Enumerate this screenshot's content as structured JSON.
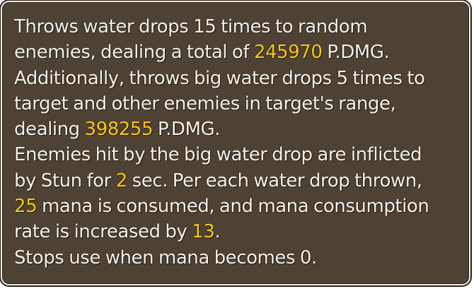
{
  "tooltip": {
    "lines": [
      {
        "a": "Throws water drops 15 times to random"
      },
      {
        "a": "enemies, dealing a total of ",
        "v": "245970",
        "b": " P.DMG."
      },
      {
        "a": "Additionally, throws big water drops 5 times to"
      },
      {
        "a": "target and other enemies in target's range,"
      },
      {
        "a": "dealing ",
        "v": "398255",
        "b": " P.DMG."
      },
      {
        "a": "Enemies hit by the big water drop are inflicted"
      },
      {
        "a": "by Stun for ",
        "v": "2",
        "b": " sec. Per each water drop thrown,"
      },
      {
        "v": "25",
        "b": " mana is consumed, and mana consumption"
      },
      {
        "a": "rate is increased by ",
        "v": "13",
        "b": "."
      },
      {
        "a": "Stops use when mana becomes 0."
      }
    ]
  },
  "colors": {
    "background": "#4d4234",
    "text": "#f4f2ea",
    "highlight": "#ffc815",
    "border": "#f3efe6"
  }
}
